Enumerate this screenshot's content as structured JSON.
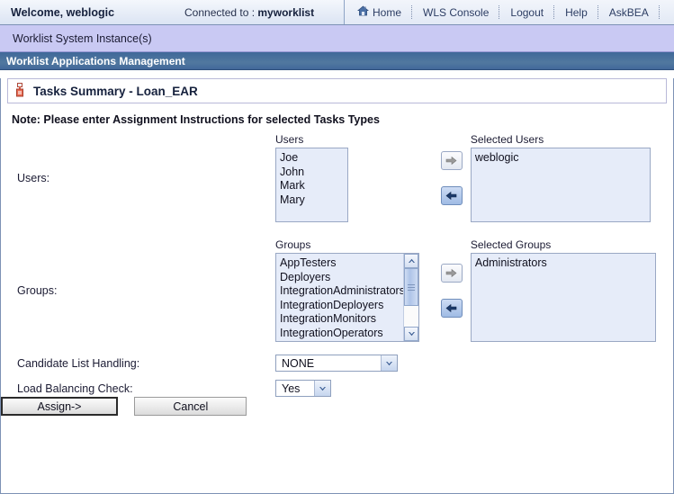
{
  "topbar": {
    "welcome": "Welcome, weblogic",
    "connected_prefix": "Connected to : ",
    "connected_value": "myworklist",
    "nav": [
      {
        "label": "Home",
        "icon": "home-icon"
      },
      {
        "label": "WLS Console",
        "icon": ""
      },
      {
        "label": "Logout",
        "icon": ""
      },
      {
        "label": "Help",
        "icon": ""
      },
      {
        "label": "AskBEA",
        "icon": ""
      }
    ]
  },
  "instance_bar": {
    "label": "Worklist System Instance(s)"
  },
  "section_bar": {
    "label": "Worklist Applications Management"
  },
  "page": {
    "title": "Tasks Summary - Loan_EAR",
    "title_icon": "document-icon",
    "note": "Note: Please enter Assignment Instructions for selected Tasks Types"
  },
  "users_row": {
    "label": "Users:",
    "available_caption": "Users",
    "available_items": [
      "Joe",
      "John",
      "Mark",
      "Mary"
    ],
    "selected_caption": "Selected Users",
    "selected_items": [
      "weblogic"
    ],
    "add_button": {
      "name": "arrow-right-icon",
      "enabled": false
    },
    "remove_button": {
      "name": "arrow-left-icon",
      "enabled": true
    }
  },
  "groups_row": {
    "label": "Groups:",
    "available_caption": "Groups",
    "available_items": [
      "AppTesters",
      "Deployers",
      "IntegrationAdministrators",
      "IntegrationDeployers",
      "IntegrationMonitors",
      "IntegrationOperators"
    ],
    "selected_caption": "Selected Groups",
    "selected_items": [
      "Administrators"
    ],
    "add_button": {
      "name": "arrow-right-icon",
      "enabled": false
    },
    "remove_button": {
      "name": "arrow-left-icon",
      "enabled": true
    },
    "scrollbar": {
      "up": "scroll-up-icon",
      "down": "scroll-down-icon"
    }
  },
  "candidate_list": {
    "label": "Candidate List Handling:",
    "value": "NONE"
  },
  "load_balancing": {
    "label": "Load Balancing Check:",
    "value": "Yes"
  },
  "actions": {
    "assign_label": "Assign->",
    "cancel_label": "Cancel"
  },
  "colors": {
    "section_bar_bg": "#42689a",
    "instance_bar_bg": "#c9c9f3",
    "listbox_bg": "#e6ecf9",
    "accent_blue": "#2c3d63"
  }
}
